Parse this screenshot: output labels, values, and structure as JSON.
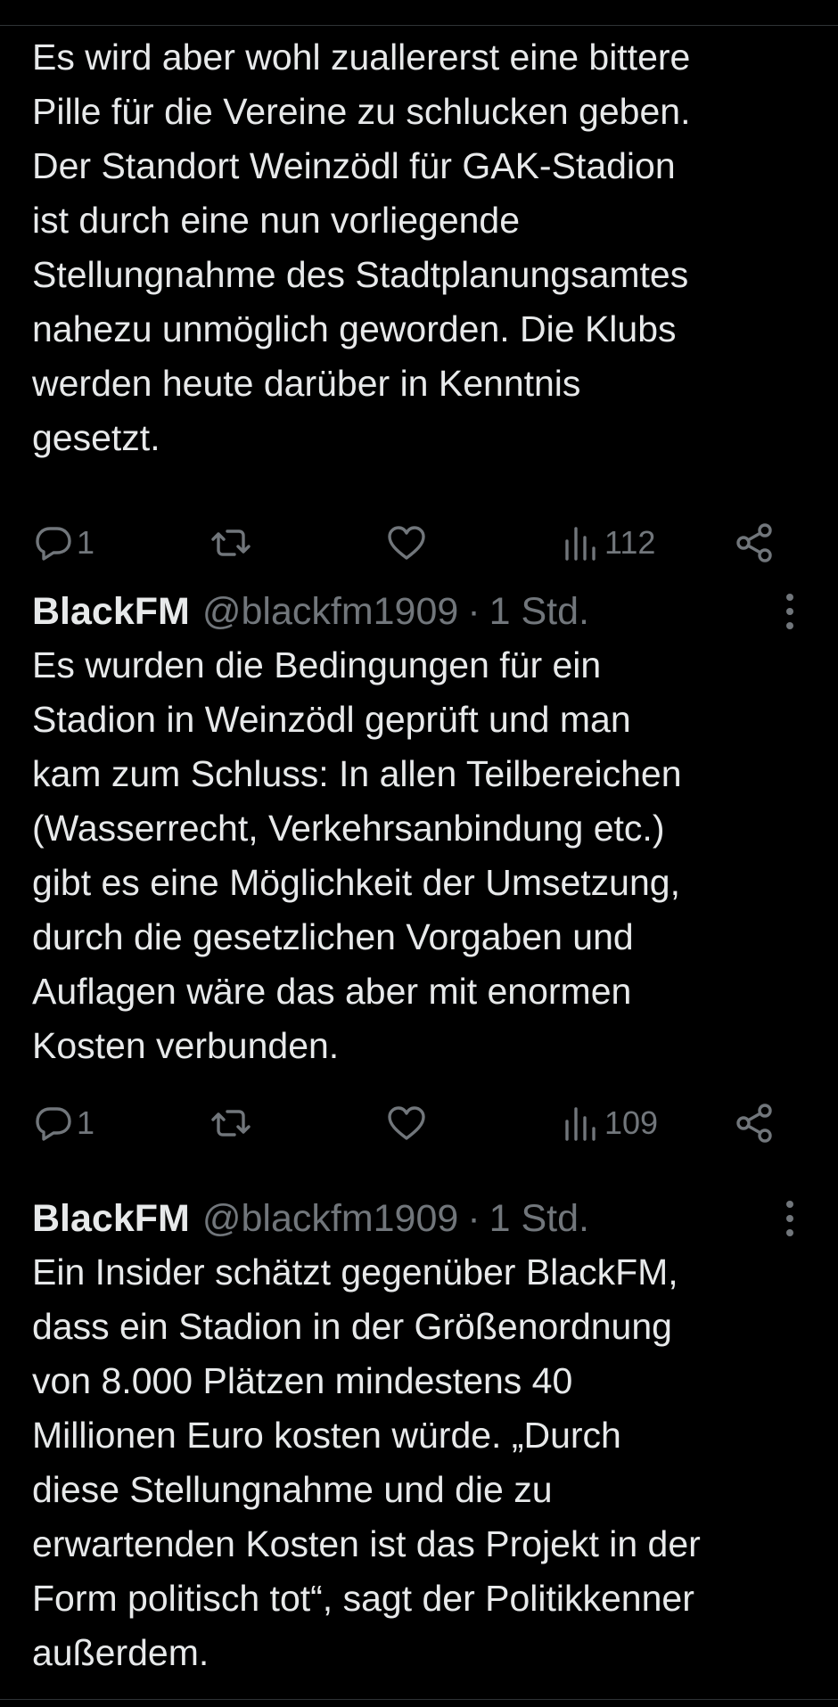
{
  "tweets": [
    {
      "display_name": "",
      "handle": "",
      "time": "",
      "text": "Es wird aber wohl zuallererst eine bittere\nPille für die Vereine zu schlucken geben.\nDer Standort Weinzödl für GAK-Stadion\nist durch eine nun vorliegende\nStellungnahme des Stadtplanungsamtes\nnahezu unmöglich geworden. Die Klubs\nwerden heute darüber in Kenntnis\ngesetzt.",
      "replies": "1",
      "reposts": "",
      "likes": "",
      "views": "112"
    },
    {
      "display_name": "BlackFM",
      "handle": "@blackfm1909",
      "separator": "·",
      "time": "1 Std.",
      "text": "Es wurden die Bedingungen für ein\nStadion in Weinzödl geprüft und man\nkam zum Schluss: In allen Teilbereichen\n(Wasserrecht, Verkehrsanbindung etc.)\ngibt es eine Möglichkeit der Umsetzung,\ndurch die gesetzlichen Vorgaben und\nAuflagen wäre das aber mit enormen\nKosten verbunden.",
      "replies": "1",
      "reposts": "",
      "likes": "",
      "views": "109"
    },
    {
      "display_name": "BlackFM",
      "handle": "@blackfm1909",
      "separator": "·",
      "time": "1 Std.",
      "text": "Ein Insider schätzt gegenüber BlackFM,\ndass ein Stadion in der Größenordnung\nvon 8.000 Plätzen mindestens 40\nMillionen Euro kosten würde. „Durch\ndiese Stellungnahme und die zu\nerwartenden Kosten ist das Projekt in der\nForm politisch tot“, sagt der Politikkenner\naußerdem."
    }
  ],
  "icons": {
    "reply": "reply-icon",
    "repost": "repost-icon",
    "like": "heart-icon",
    "views": "views-icon",
    "share": "share-icon",
    "more": "more-icon"
  },
  "colors": {
    "background": "#000000",
    "text": "#e7e9ea",
    "secondary": "#71767b",
    "divider": "#2f3336"
  }
}
